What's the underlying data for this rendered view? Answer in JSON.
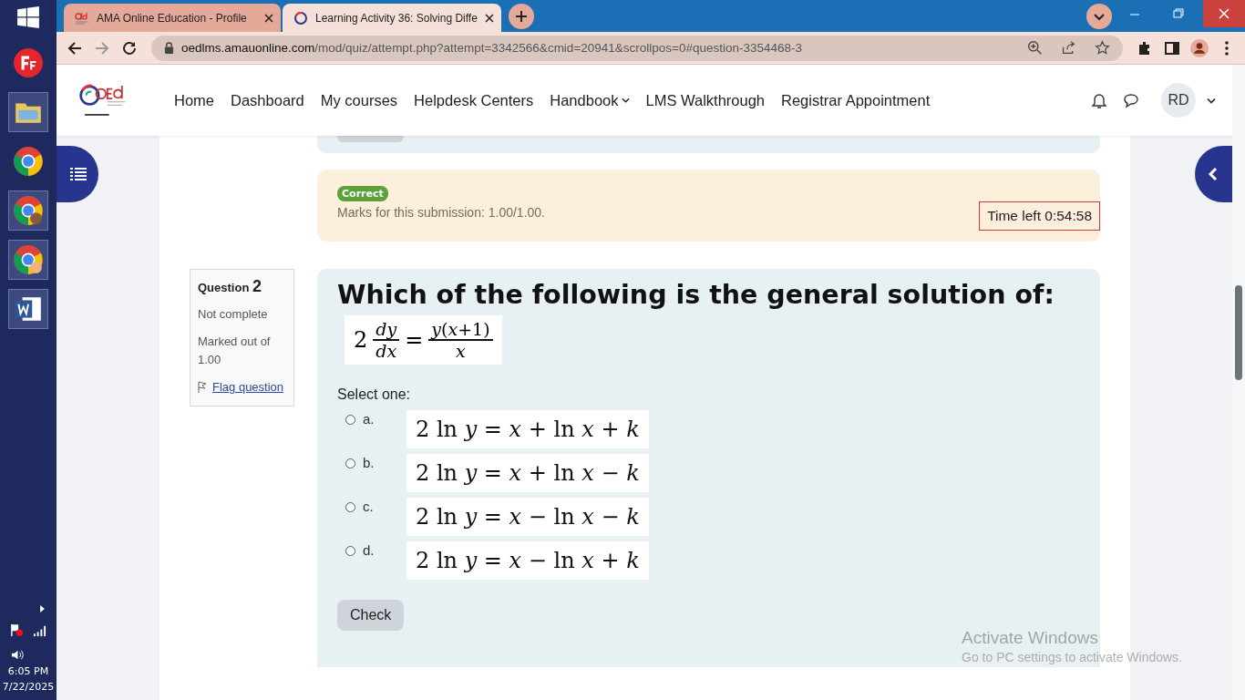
{
  "taskbar": {
    "clock": {
      "time": "6:05 PM",
      "date": "7/22/2025"
    }
  },
  "browser": {
    "tabs": [
      {
        "title": "AMA Online Education - Profile",
        "selected": false
      },
      {
        "title": "Learning Activity 36: Solving Diffe",
        "selected": true
      }
    ],
    "url": {
      "host": "oedlms.amauonline.com",
      "path": "/mod/quiz/attempt.php?attempt=3342566&cmid=20941&scrollpos=0#question-3354468-3"
    }
  },
  "navbar": {
    "items": [
      {
        "label": "Home",
        "dropdown": false
      },
      {
        "label": "Dashboard",
        "dropdown": false
      },
      {
        "label": "My courses",
        "dropdown": false
      },
      {
        "label": "Helpdesk Centers",
        "dropdown": false
      },
      {
        "label": "Handbook",
        "dropdown": true
      },
      {
        "label": "LMS Walkthrough",
        "dropdown": false
      },
      {
        "label": "Registrar Appointment",
        "dropdown": false
      }
    ],
    "user_initials": "RD"
  },
  "previous_feedback": {
    "status": "Correct",
    "marks": "Marks for this submission: 1.00/1.00."
  },
  "timer": "Time left 0:54:58",
  "question": {
    "label": "Question",
    "number": "2",
    "state": "Not complete",
    "marked_out_of": "Marked out of 1.00",
    "flag": "Flag question",
    "flagged": false,
    "prompt": "Which of the following is the general solution of:",
    "equation": {
      "coefficient": "2",
      "left_numerator": "*dy*",
      "left_denominator": "*dx*",
      "equals": "=",
      "right_numerator": "*y*(*x*+1)",
      "right_denominator": "*x*"
    },
    "select_label": "Select one:",
    "options": [
      {
        "letter": "a.",
        "formula": "2 ln *y* = *x* + ln *x* + *k*",
        "selected": false
      },
      {
        "letter": "b.",
        "formula": "2 ln *y* = *x* + ln *x* − *k*",
        "selected": false
      },
      {
        "letter": "c.",
        "formula": "2 ln *y* = *x* − ln *x* − *k*",
        "selected": false
      },
      {
        "letter": "d.",
        "formula": "2 ln *y* = *x* − ln *x* + *k*",
        "selected": false
      }
    ],
    "check_button": "Check"
  },
  "os_notice": {
    "title": "Activate Windows",
    "subtitle": "Go to PC settings to activate Windows."
  }
}
